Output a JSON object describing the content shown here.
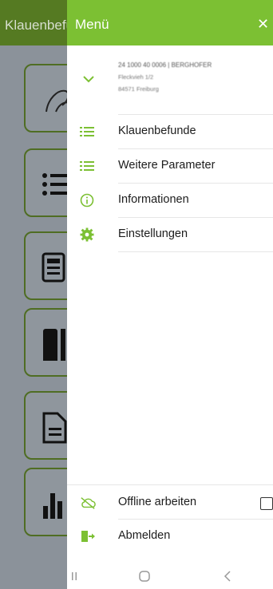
{
  "background": {
    "title": "Klauenbefunde",
    "tiles": [
      "hoof",
      "list",
      "document",
      "panel",
      "file",
      "bar-chart"
    ]
  },
  "drawer": {
    "title": "Menü",
    "close_icon": "close-icon",
    "profile": {
      "line1": "24 1000 40 0006 | BERGHOFER",
      "line2": "Fleckvieh 1/2",
      "line3": "84571 Freiburg"
    },
    "items": [
      {
        "label": "Klauenbefunde",
        "icon": "list-icon",
        "color": "#7cc033"
      },
      {
        "label": "Weitere Parameter",
        "icon": "list-icon",
        "color": "#7cc033"
      },
      {
        "label": "Informationen",
        "icon": "info-icon",
        "color": "#7cc033"
      },
      {
        "label": "Einstellungen",
        "icon": "gear-icon",
        "color": "#7cc033"
      }
    ],
    "footer": {
      "offline_label": "Offline arbeiten",
      "offline_checked": false,
      "logout_label": "Abmelden"
    }
  },
  "colors": {
    "accent": "#7cc033",
    "dim_header": "#557a22"
  }
}
